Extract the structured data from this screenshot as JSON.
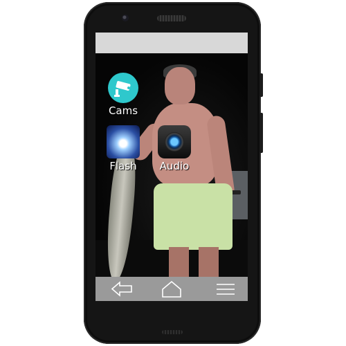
{
  "apps": [
    {
      "label": "Cams",
      "icon": "cctv-camera-icon"
    },
    {
      "label": "Flash",
      "icon": "flashlight-icon"
    },
    {
      "label": "Audio",
      "icon": "speaker-icon"
    }
  ],
  "navbar": {
    "back_icon": "back-arrow-icon",
    "home_icon": "home-icon",
    "menu_icon": "menu-icon"
  },
  "colors": {
    "statusbar": "#d8d8d8",
    "navbar": "#9a9a9a",
    "cams_icon": "#2ec8cc",
    "phone_body": "#151515"
  }
}
